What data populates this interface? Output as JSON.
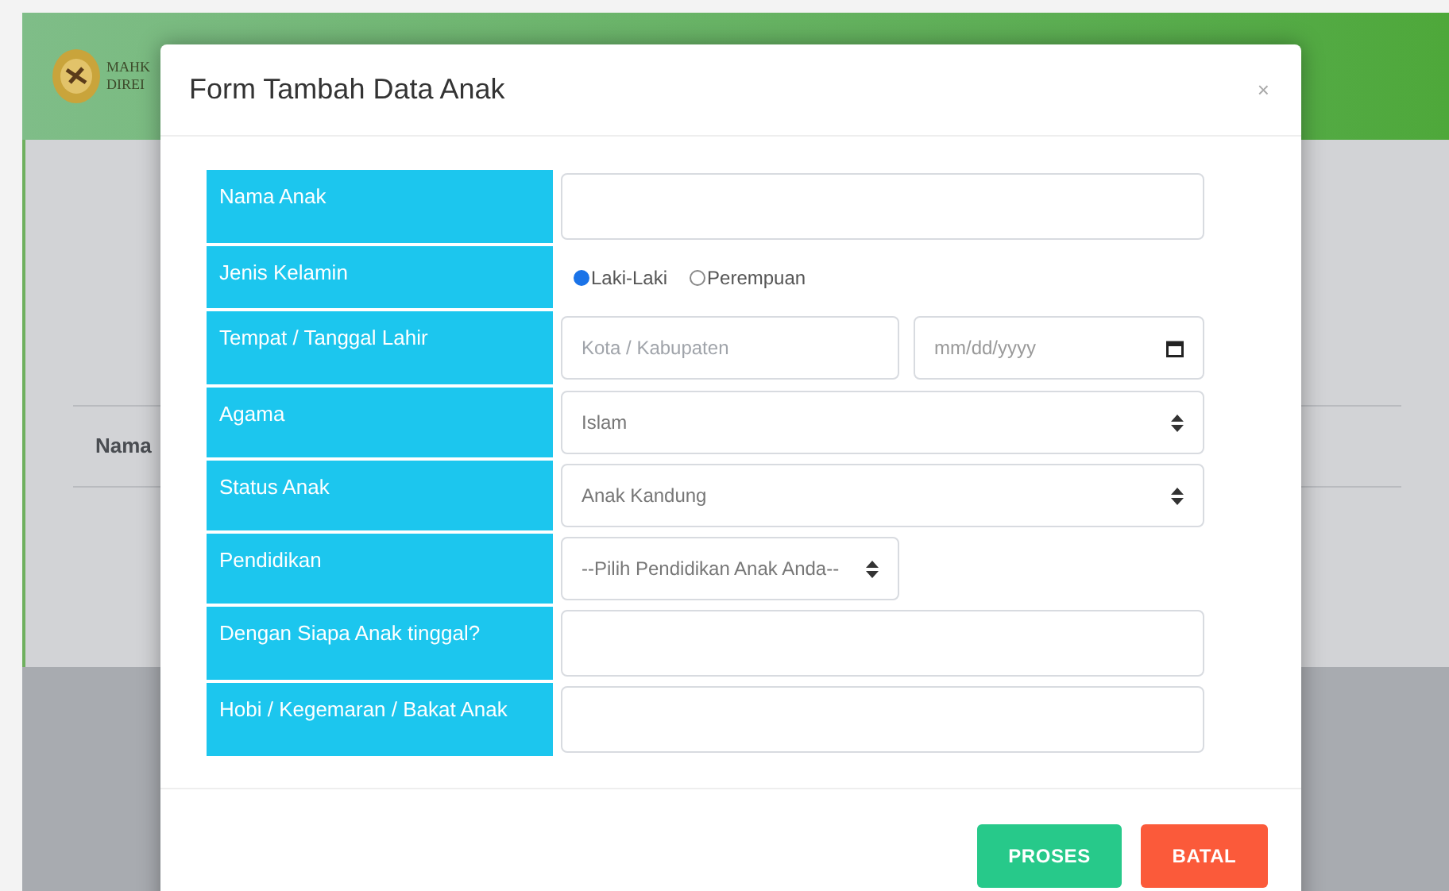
{
  "background": {
    "logo_text": [
      "MAHK",
      "DIREI"
    ],
    "table_header": "Nama"
  },
  "modal": {
    "title": "Form Tambah Data Anak",
    "close": "×",
    "rows": [
      {
        "kind": "text",
        "label": "Nama Anak"
      },
      {
        "kind": "radio",
        "label": "Jenis Kelamin",
        "options": [
          {
            "label": "Laki-Laki",
            "selected": true
          },
          {
            "label": "Perempuan",
            "selected": false
          }
        ]
      },
      {
        "kind": "place_date",
        "label": "Tempat / Tanggal Lahir",
        "placeholder": "Kota / Kabupaten",
        "date_placeholder": "mm/dd/yyyy"
      },
      {
        "kind": "select",
        "label": "Agama",
        "value": "Islam"
      },
      {
        "kind": "select",
        "label": "Status Anak",
        "value": "Anak Kandung"
      },
      {
        "kind": "select_short",
        "label": "Pendidikan",
        "value": "--Pilih Pendidikan Anak Anda--"
      },
      {
        "kind": "text",
        "label": "Dengan Siapa Anak tinggal?"
      },
      {
        "kind": "text",
        "label": "Hobi / Kegemaran / Bakat Anak"
      }
    ],
    "buttons": [
      {
        "label": "PROSES",
        "kind": "primary"
      },
      {
        "label": "BATAL",
        "kind": "danger"
      }
    ]
  }
}
